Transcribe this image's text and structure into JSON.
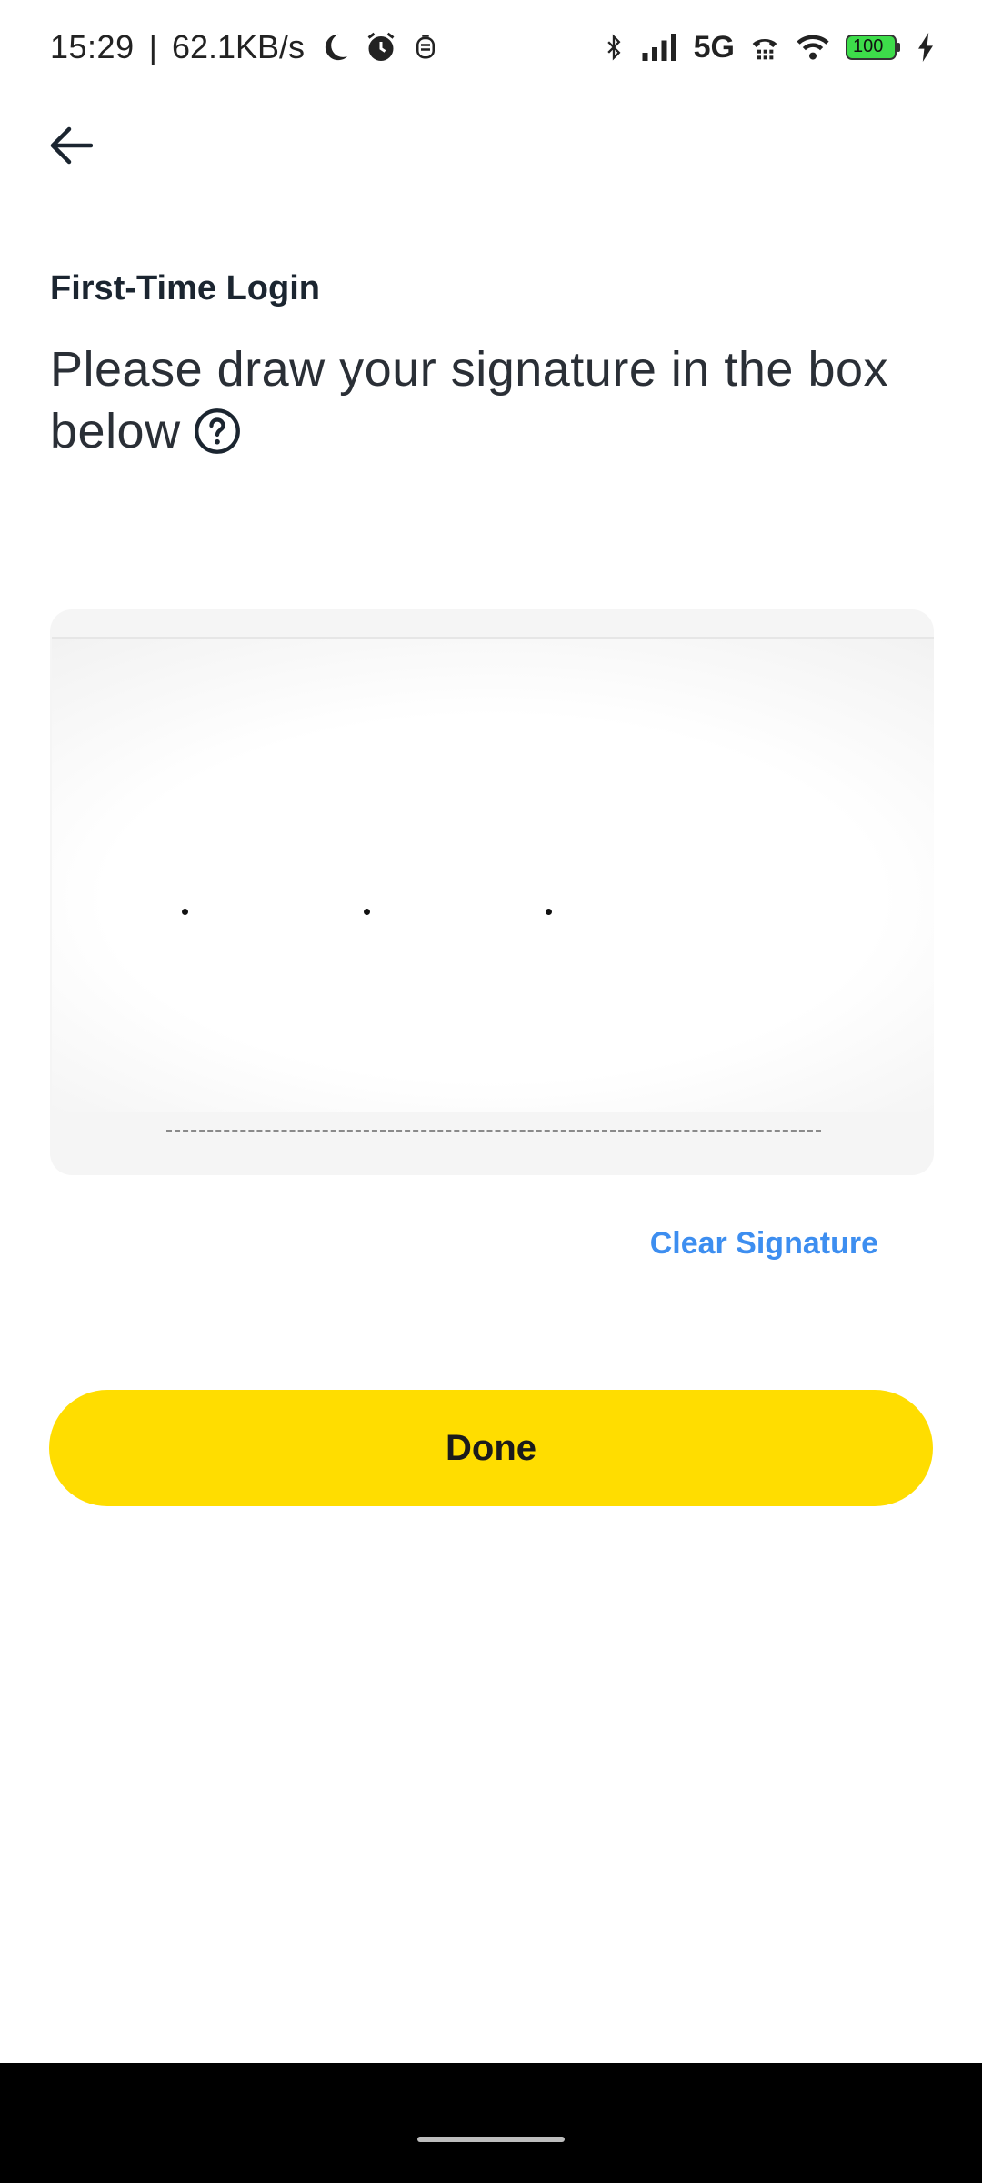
{
  "status_bar": {
    "time": "15:29",
    "separator": "|",
    "speed": "62.1KB/s",
    "network": "5G",
    "battery": "100",
    "icons_left": [
      "moon-icon",
      "alarm-icon",
      "notification-icon"
    ],
    "icons_right": [
      "bluetooth-icon",
      "signal-icon",
      "network-label",
      "call-icon",
      "wifi-icon",
      "battery-icon",
      "charging-icon"
    ],
    "battery_color": "#3ddc4a"
  },
  "header": {
    "back_icon": "arrow-left-icon"
  },
  "content": {
    "subtitle": "First-Time Login",
    "heading": "Please draw your signature in the box below",
    "help_icon": "question-circle-icon"
  },
  "signature": {
    "marks_visible": true,
    "dot_count": 3
  },
  "actions": {
    "clear_label": "Clear Signature",
    "done_label": "Done"
  },
  "colors": {
    "accent_yellow": "#ffdd00",
    "link_blue": "#3d8ef0",
    "text_dark": "#1b2530"
  }
}
